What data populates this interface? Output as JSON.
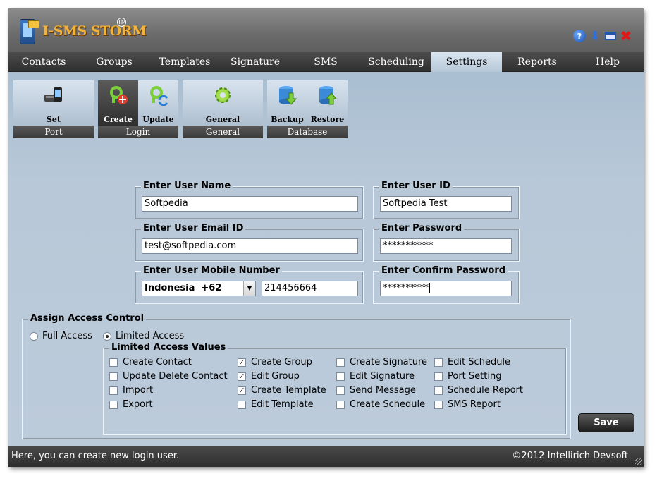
{
  "app": {
    "logo_text": "I-SMS STORM",
    "tm": "TM"
  },
  "window_controls": [
    "help-icon",
    "minimize-icon",
    "maximize-icon",
    "close-icon"
  ],
  "menu": [
    {
      "label": "Contacts"
    },
    {
      "label": "Groups"
    },
    {
      "label": "Templates"
    },
    {
      "label": "Signature"
    },
    {
      "label": "SMS"
    },
    {
      "label": "Scheduling"
    },
    {
      "label": "Settings",
      "active": true
    },
    {
      "label": "Reports"
    },
    {
      "label": "Help"
    }
  ],
  "toolbar": {
    "port": {
      "caption": "Port",
      "set": "Set"
    },
    "login": {
      "caption": "Login",
      "create": "Create",
      "update": "Update"
    },
    "general": {
      "caption": "General",
      "general": "General"
    },
    "database": {
      "caption": "Database",
      "backup": "Backup",
      "restore": "Restore"
    }
  },
  "form": {
    "user_name": {
      "legend": "Enter User Name",
      "value": "Softpedia"
    },
    "user_id": {
      "legend": "Enter User ID",
      "value": "Softpedia Test"
    },
    "email": {
      "legend": "Enter User Email ID",
      "value": "test@softpedia.com"
    },
    "password": {
      "legend": "Enter Password",
      "value": "***********"
    },
    "mobile": {
      "legend": "Enter User Mobile Number",
      "country": "Indonesia  +62",
      "number": "214456664"
    },
    "confirm_password": {
      "legend": "Enter Confirm Password",
      "value": "**********"
    }
  },
  "access": {
    "legend": "Assign Access Control",
    "full_access": "Full Access",
    "limited_access": "Limited Access",
    "selected": "Limited Access",
    "values_legend": "Limited Access Values",
    "columns": [
      [
        {
          "label": "Create Contact",
          "checked": false
        },
        {
          "label": "Update Delete Contact",
          "checked": false
        },
        {
          "label": "Import",
          "checked": false
        },
        {
          "label": "Export",
          "checked": false
        }
      ],
      [
        {
          "label": "Create Group",
          "checked": true
        },
        {
          "label": "Edit Group",
          "checked": true
        },
        {
          "label": "Create Template",
          "checked": true
        },
        {
          "label": "Edit Template",
          "checked": false
        }
      ],
      [
        {
          "label": "Create Signature",
          "checked": false
        },
        {
          "label": "Edit Signature",
          "checked": false
        },
        {
          "label": "Send Message",
          "checked": false
        },
        {
          "label": "Create Schedule",
          "checked": false
        }
      ],
      [
        {
          "label": "Edit Schedule",
          "checked": false
        },
        {
          "label": "Port Setting",
          "checked": false
        },
        {
          "label": "Schedule Report",
          "checked": false
        },
        {
          "label": "SMS Report",
          "checked": false
        }
      ]
    ]
  },
  "save_label": "Save",
  "status": {
    "message": "Here, you can create new login user.",
    "copyright": "©2012 Intellirich Devsoft"
  }
}
